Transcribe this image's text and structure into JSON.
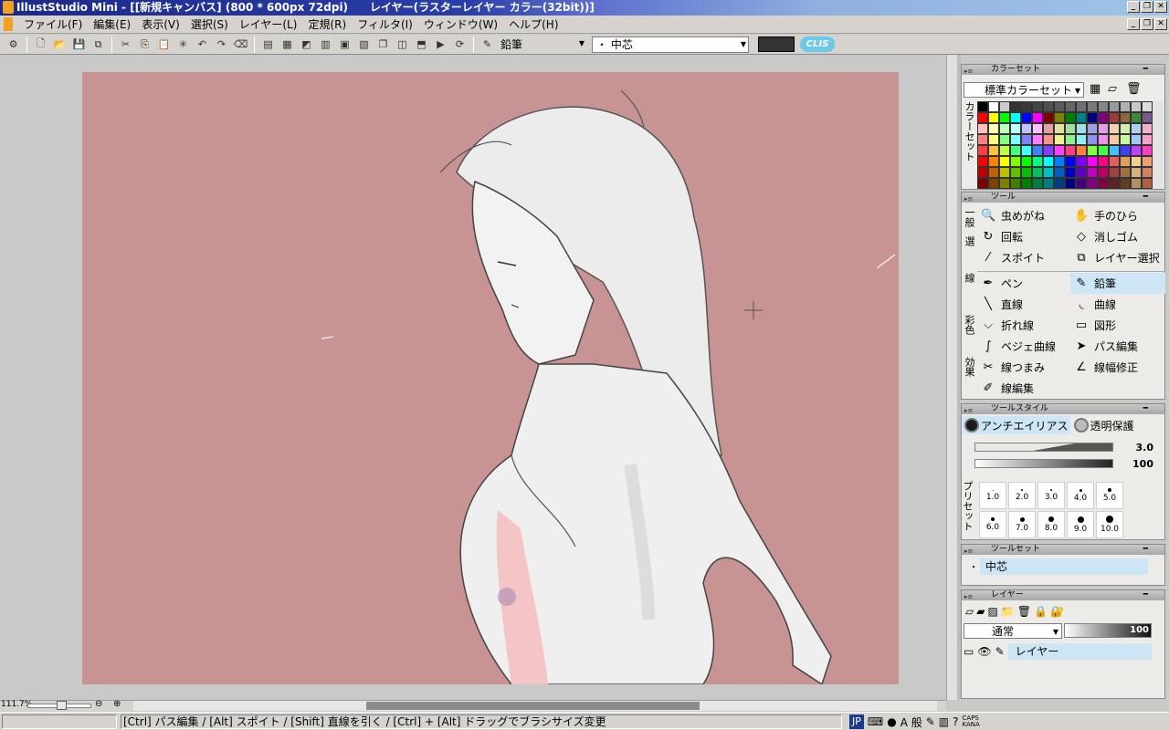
{
  "window": {
    "title": "IllustStudio Mini - [[新規キャンバス] (800 * 600px 72dpi)　　レイヤー(ラスターレイヤー カラー(32bit))]",
    "controls": [
      "_",
      "❐",
      "✕"
    ]
  },
  "menubar": {
    "items": [
      "ファイル(F)",
      "編集(E)",
      "表示(V)",
      "選択(S)",
      "レイヤー(L)",
      "定規(R)",
      "フィルタ(I)",
      "ウィンドウ(W)",
      "ヘルプ(H)"
    ]
  },
  "toolbar": {
    "tool_name": "鉛筆",
    "brush_tip": "・ 中芯",
    "current_color": "#333333",
    "logo": "CLIS"
  },
  "canvas": {
    "background_color": "#c89393"
  },
  "zoom": {
    "label": "111.7%"
  },
  "statusbar": {
    "hint": "[Ctrl] パス編集 / [Alt] スポイト / [Shift] 直線を引く / [Ctrl] + [Alt] ドラッグでブラシサイズ変更",
    "ime_lang": "JP",
    "ime_mode": "A 般",
    "caps": "CAPS",
    "kana": "KANA"
  },
  "colorset_panel": {
    "title": "カラーセット",
    "selected_set": "標準カラーセット",
    "side_label": "カラーセット",
    "swatches": [
      "#000000",
      "#ffffff",
      "#cccccc",
      "#333333",
      "#3a3a3a",
      "#444444",
      "#4f4f4f",
      "#5a5a5a",
      "#656565",
      "#707070",
      "#7b7b7b",
      "#868686",
      "#9a9a9a",
      "#b0b0b0",
      "#c6c6c6",
      "#dcdcdc",
      "#ff0000",
      "#ffff00",
      "#00ff00",
      "#00ffff",
      "#0000ff",
      "#ff00ff",
      "#800000",
      "#808000",
      "#008000",
      "#008080",
      "#000080",
      "#800080",
      "#a03a3a",
      "#8a6a3a",
      "#3a8a3a",
      "#7a5a8a",
      "#ffc0c0",
      "#ffffc0",
      "#c0ffc0",
      "#c0ffff",
      "#c0c0ff",
      "#ffc0ff",
      "#e0a0a0",
      "#e0e0a0",
      "#a0e0a0",
      "#a0e0e0",
      "#a0a0e0",
      "#e0a0e0",
      "#f0d0b0",
      "#d0f0b0",
      "#b0d0f0",
      "#f0b0d0",
      "#ff8080",
      "#ffff80",
      "#80ff80",
      "#80ffff",
      "#8080ff",
      "#ff80ff",
      "#ff9090",
      "#f0f090",
      "#90f090",
      "#90f0f0",
      "#9090f0",
      "#f090f0",
      "#f8c8a0",
      "#c8f8a0",
      "#a0c8f8",
      "#f8a0c8",
      "#ff4040",
      "#ffc040",
      "#c0ff40",
      "#40ff80",
      "#40ffff",
      "#4080ff",
      "#8040ff",
      "#ff40ff",
      "#ff4080",
      "#ff8040",
      "#80ff40",
      "#40ff40",
      "#40c0ff",
      "#4040ff",
      "#c040ff",
      "#ff40c0",
      "#ff0000",
      "#ff8000",
      "#ffff00",
      "#80ff00",
      "#00ff00",
      "#00ff80",
      "#00ffff",
      "#0080ff",
      "#0000ff",
      "#8000ff",
      "#ff00ff",
      "#ff0080",
      "#e06060",
      "#e0a060",
      "#f0d090",
      "#f0a070",
      "#c00000",
      "#c06000",
      "#c0c000",
      "#60c000",
      "#00c000",
      "#00c060",
      "#00c0c0",
      "#0060c0",
      "#0000c0",
      "#6000c0",
      "#c000c0",
      "#c00060",
      "#a04040",
      "#a07040",
      "#d0b080",
      "#d08060",
      "#800000",
      "#804000",
      "#808000",
      "#408000",
      "#008000",
      "#008040",
      "#008080",
      "#004080",
      "#000080",
      "#400080",
      "#800080",
      "#800040",
      "#602020",
      "#604020",
      "#b09060",
      "#b06040"
    ]
  },
  "tool_panel": {
    "title": "ツール",
    "side_labels": [
      "一般",
      "選",
      "線",
      "彩色",
      "効果"
    ],
    "general": [
      {
        "icon": "magnifier-icon",
        "glyph": "🔍",
        "label": "虫めがね"
      },
      {
        "icon": "hand-icon",
        "glyph": "✋",
        "label": "手のひら"
      },
      {
        "icon": "rotate-icon",
        "glyph": "↻",
        "label": "回転"
      },
      {
        "icon": "eraser-icon",
        "glyph": "◇",
        "label": "消しゴム"
      },
      {
        "icon": "eyedropper-icon",
        "glyph": "⁄",
        "label": "スポイト"
      },
      {
        "icon": "layer-select-icon",
        "glyph": "⧉",
        "label": "レイヤー選択"
      }
    ],
    "line": [
      {
        "icon": "pen-icon",
        "glyph": "✒",
        "label": "ペン",
        "selected": false
      },
      {
        "icon": "pencil-icon",
        "glyph": "✎",
        "label": "鉛筆",
        "selected": true
      },
      {
        "icon": "straight-line-icon",
        "glyph": "╲",
        "label": "直線",
        "selected": false
      },
      {
        "icon": "curve-icon",
        "glyph": "◟",
        "label": "曲線",
        "selected": false
      },
      {
        "icon": "polyline-icon",
        "glyph": "⌵",
        "label": "折れ線",
        "selected": false
      },
      {
        "icon": "shape-icon",
        "glyph": "▭",
        "label": "図形",
        "selected": false
      },
      {
        "icon": "bezier-icon",
        "glyph": "∫",
        "label": "ベジェ曲線",
        "selected": false
      },
      {
        "icon": "path-edit-icon",
        "glyph": "➤",
        "label": "パス編集",
        "selected": false
      },
      {
        "icon": "line-pinch-icon",
        "glyph": "✂",
        "label": "線つまみ",
        "selected": false
      },
      {
        "icon": "line-width-icon",
        "glyph": "∠",
        "label": "線幅修正",
        "selected": false
      },
      {
        "icon": "line-edit-icon",
        "glyph": "✐",
        "label": "線編集",
        "selected": false
      },
      {
        "icon": "",
        "glyph": "",
        "label": "",
        "selected": false
      }
    ]
  },
  "toolstyle_panel": {
    "title": "ツールスタイル",
    "antialias_label": "アンチエイリアス",
    "protect_label": "透明保護",
    "size_value": "3.0",
    "opacity_value": "100",
    "preset_side_label": "プリセット",
    "presets": [
      {
        "size": "1.0",
        "dot": 1
      },
      {
        "size": "2.0",
        "dot": 2
      },
      {
        "size": "3.0",
        "dot": 2
      },
      {
        "size": "4.0",
        "dot": 3
      },
      {
        "size": "5.0",
        "dot": 4
      },
      {
        "size": "6.0",
        "dot": 4
      },
      {
        "size": "7.0",
        "dot": 5
      },
      {
        "size": "8.0",
        "dot": 6
      },
      {
        "size": "9.0",
        "dot": 7
      },
      {
        "size": "10.0",
        "dot": 8
      }
    ]
  },
  "toolset_panel": {
    "title": "ツールセット",
    "item": "中芯"
  },
  "layer_panel": {
    "title": "レイヤー",
    "blend_mode": "通常",
    "opacity": "100",
    "layer_name": "レイヤー"
  }
}
